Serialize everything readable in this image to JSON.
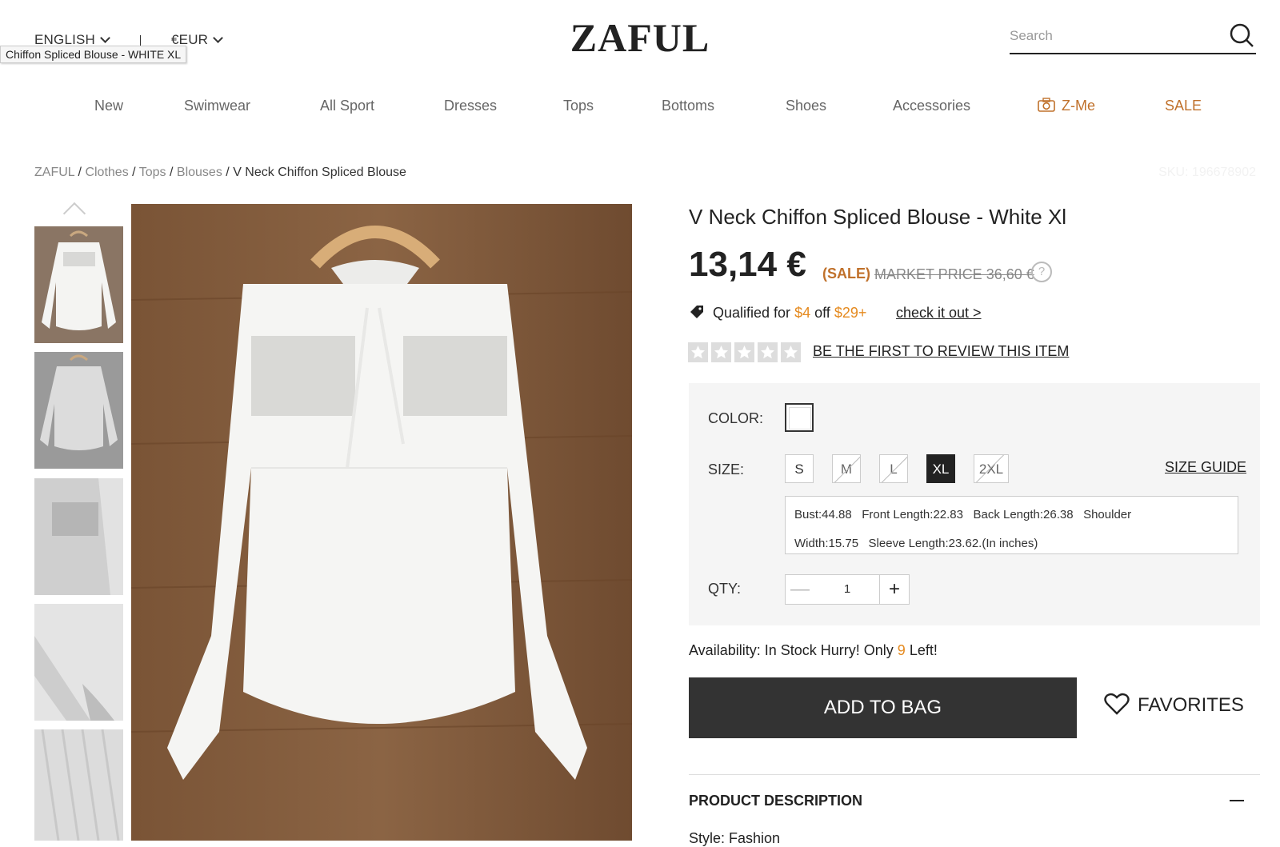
{
  "header": {
    "language": "ENGLISH",
    "currency": "€EUR",
    "tooltip": "Chiffon Spliced Blouse - WHITE XL",
    "logo": "ZAFUL",
    "search_placeholder": "Search"
  },
  "nav": {
    "items": [
      "New",
      "Swimwear",
      "All Sport",
      "Dresses",
      "Tops",
      "Bottoms",
      "Shoes",
      "Accessories",
      "Z-Me",
      "SALE"
    ]
  },
  "breadcrumb": {
    "items": [
      "ZAFUL",
      "Clothes",
      "Tops",
      "Blouses"
    ],
    "current": "V Neck Chiffon Spliced Blouse",
    "separator": "/"
  },
  "sku": "SKU: 196678902",
  "product": {
    "title": "V Neck Chiffon Spliced Blouse - White Xl",
    "price": "13,14 €",
    "sale_label": "(SALE)",
    "market_price": "MARKET PRICE 36,60 €",
    "help_icon": "?",
    "promo": {
      "prefix": "Qualified for",
      "discount": "$4",
      "mid": "off",
      "threshold": "$29+",
      "link": "check it out >"
    },
    "review_link": "BE THE FIRST TO REVIEW THIS ITEM",
    "rating_stars": 0,
    "color_label": "COLOR:",
    "size_label": "SIZE:",
    "sizes": [
      {
        "label": "S",
        "state": "available"
      },
      {
        "label": "M",
        "state": "unavailable"
      },
      {
        "label": "L",
        "state": "unavailable"
      },
      {
        "label": "XL",
        "state": "selected"
      },
      {
        "label": "2XL",
        "state": "unavailable"
      }
    ],
    "size_guide": "SIZE GUIDE",
    "measurements_line1": "Bust:44.88   Front Length:22.83   Back Length:26.38   Shoulder",
    "measurements_line2": "Width:15.75   Sleeve Length:23.62.(In inches)",
    "qty_label": "QTY:",
    "qty_value": "1",
    "qty_minus": "—",
    "qty_plus": "+",
    "availability_prefix": "Availability: In Stock Hurry! Only",
    "availability_count": "9",
    "availability_suffix": "Left!",
    "add_to_bag": "ADD TO BAG",
    "favorites": "FAVORITES",
    "description_title": "PRODUCT DESCRIPTION",
    "description_toggle": "—",
    "style_line": "Style: Fashion"
  },
  "colors": {
    "accent": "#c0712b",
    "highlight": "#e58a1f",
    "dark": "#333333"
  }
}
